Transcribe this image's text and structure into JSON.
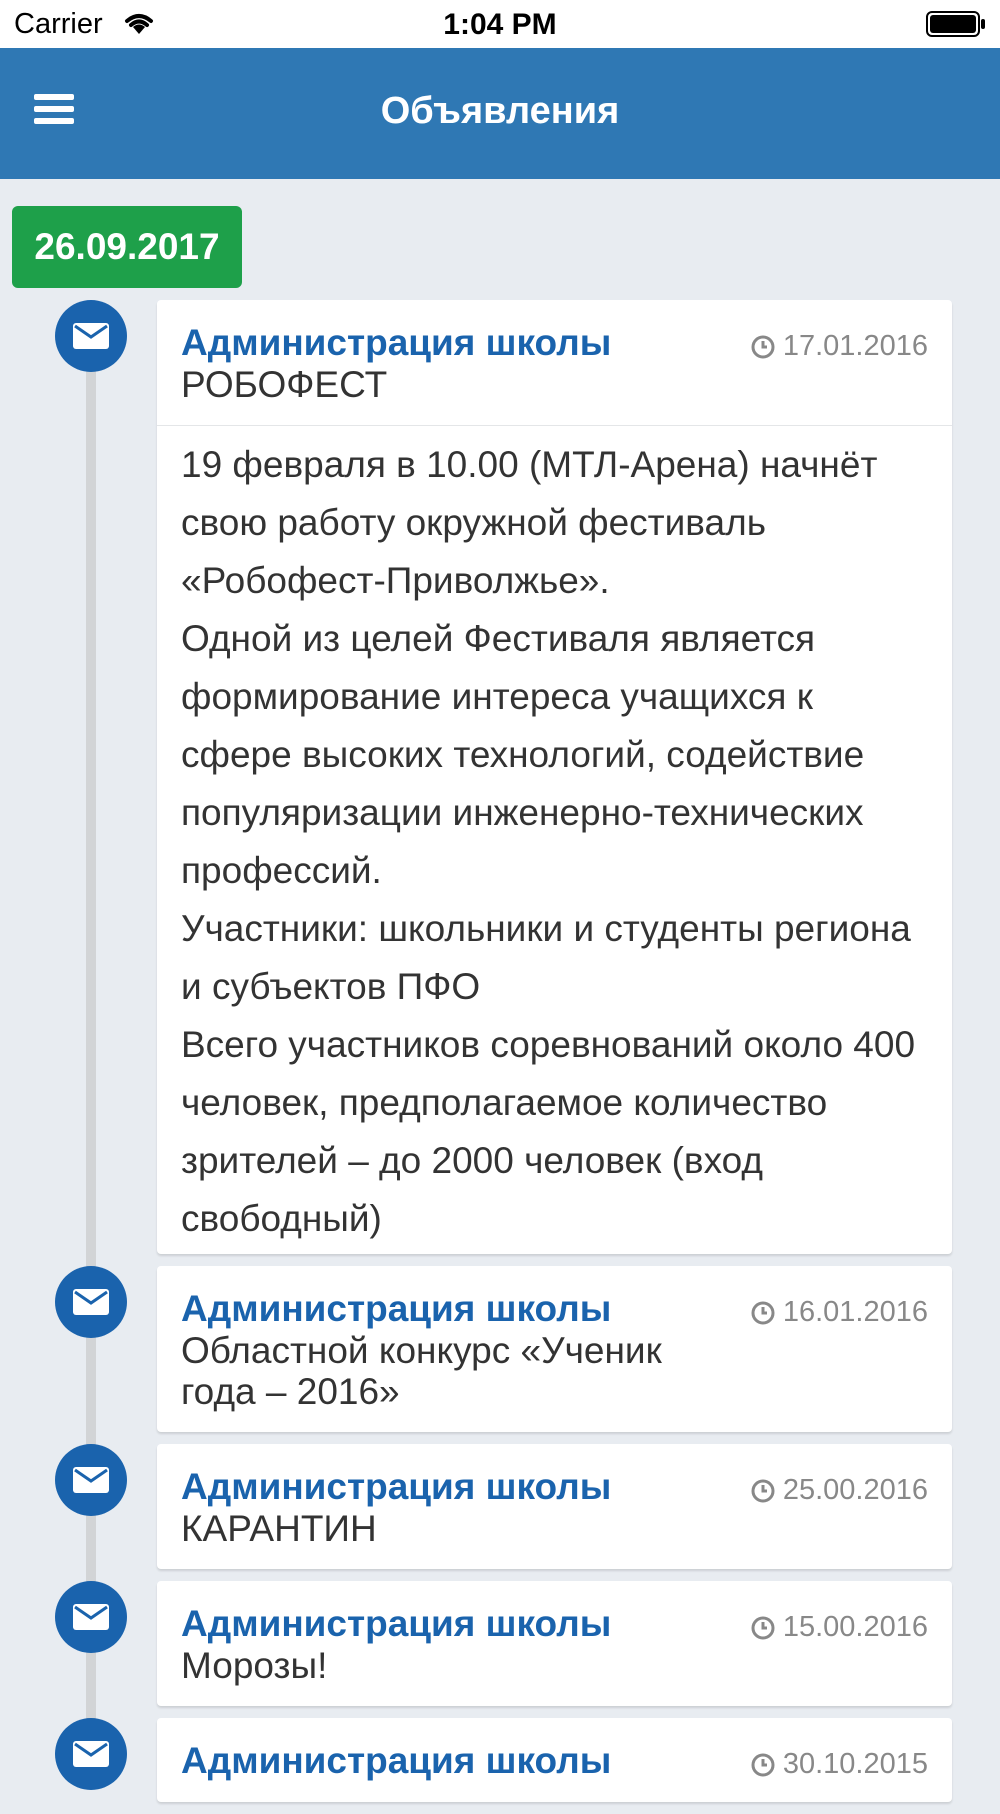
{
  "status_bar": {
    "carrier": "Carrier",
    "time": "1:04 PM"
  },
  "nav": {
    "title": "Объявления",
    "menu_icon": "hamburger-menu-icon"
  },
  "date_group": "26.09.2017",
  "colors": {
    "nav_bar": "#2f78b4",
    "date_badge": "#1ea04a",
    "author": "#1a63ad",
    "marker": "#1a63ad",
    "background": "#e8ecf1"
  },
  "entries": [
    {
      "author": "Администрация школы",
      "subject": "РОБОФЕСТ",
      "date": "17.01.2016",
      "icon": "envelope-icon",
      "body": "19 февраля в 10.00 (МТЛ-Арена) начнёт свою работу окружной фестиваль «Робофест-Приволжье».\nОдной из целей Фестиваля является формирование интереса учащихся к сфере высоких технологий, содействие популяризации инженерно-технических профессий.\nУчастники: школьники и студенты региона и субъектов ПФО\nВсего участников соревнований около 400 человек, предполагаемое количество зрителей – до 2000 человек (вход свободный)"
    },
    {
      "author": "Администрация школы",
      "subject": "Областной конкурс «Ученик года – 2016»",
      "date": "16.01.2016",
      "icon": "envelope-icon"
    },
    {
      "author": "Администрация школы",
      "subject": "КАРАНТИН",
      "date": "25.00.2016",
      "icon": "envelope-icon"
    },
    {
      "author": "Администрация школы",
      "subject": "Морозы!",
      "date": "15.00.2016",
      "icon": "envelope-icon"
    },
    {
      "author": "Администрация школы",
      "subject": "",
      "date": "30.10.2015",
      "icon": "envelope-icon"
    }
  ]
}
